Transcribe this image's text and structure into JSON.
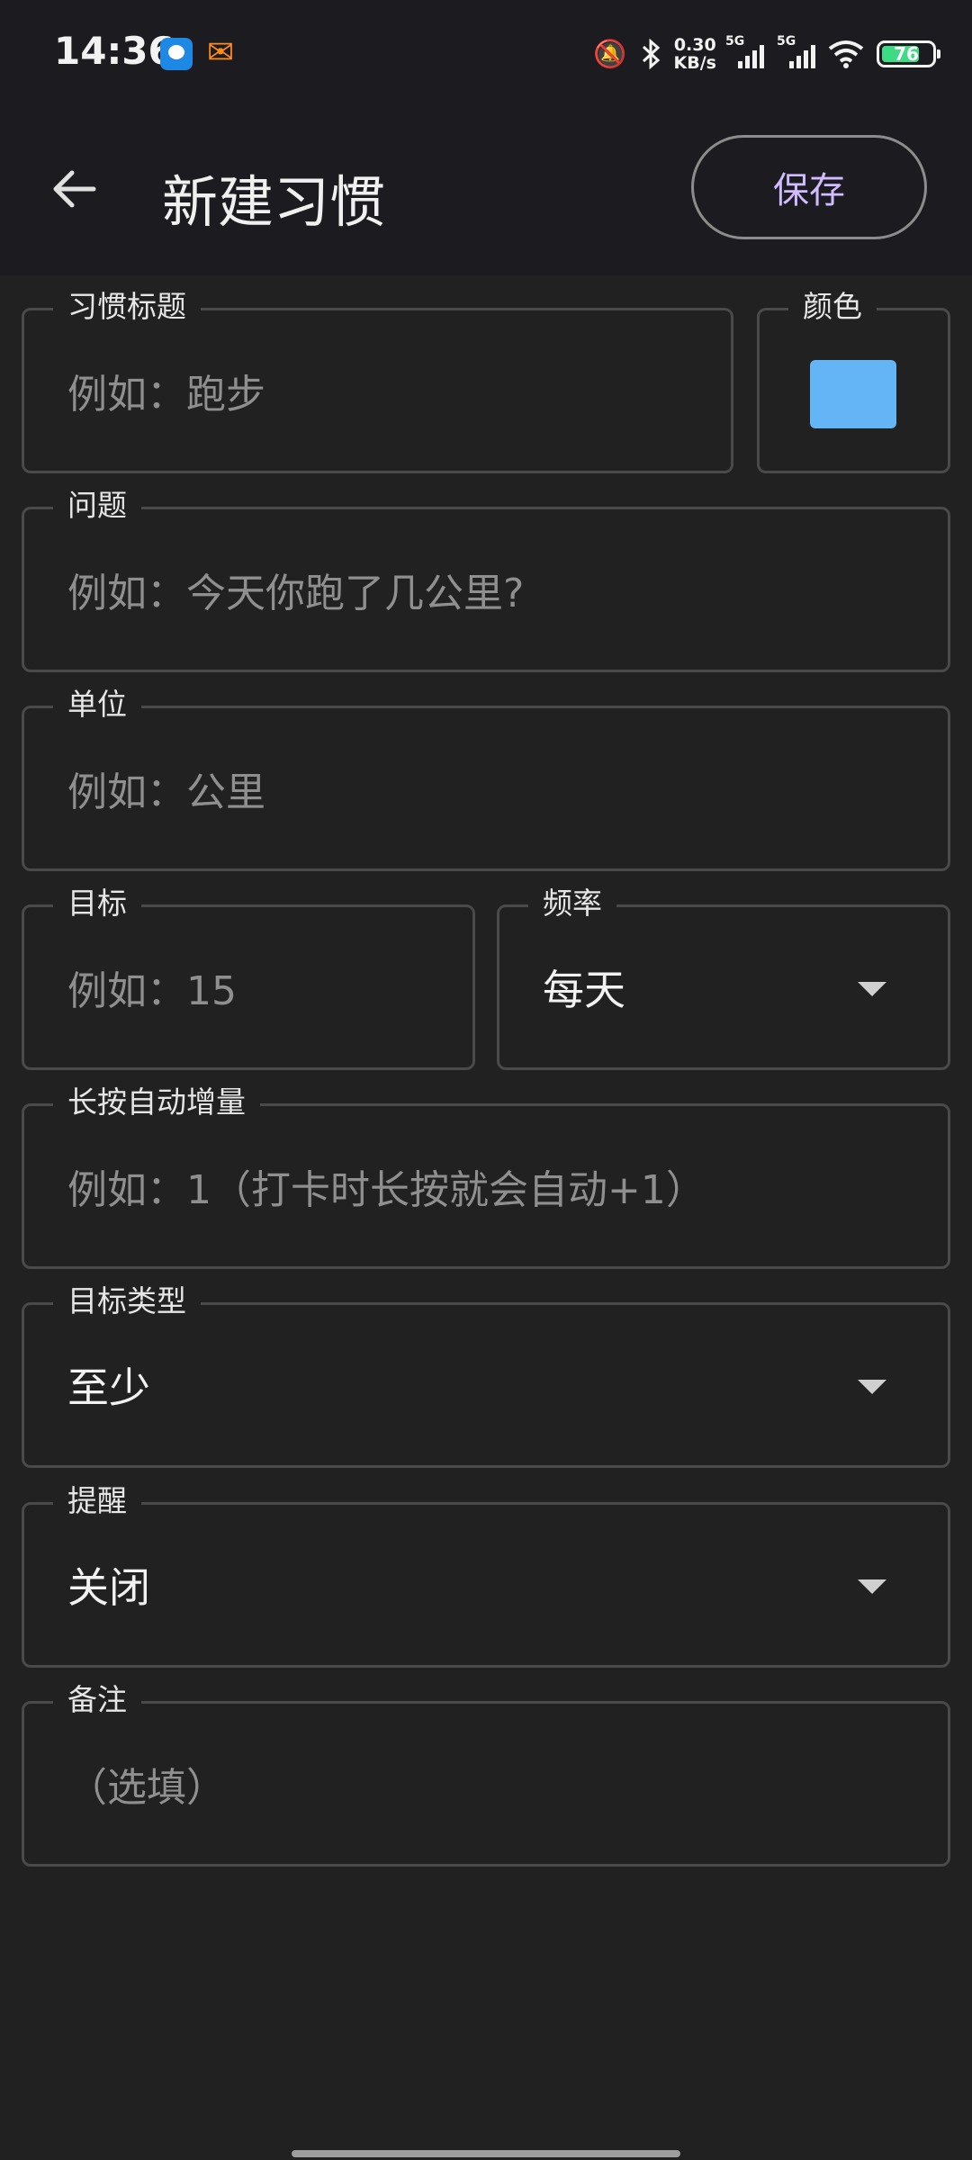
{
  "status_bar": {
    "time": "14:36",
    "net_speed_value": "0.30",
    "net_speed_unit": "KB/s",
    "sim1_tag": "5G",
    "sim2_tag": "5G",
    "battery_percent": "76",
    "battery_level": 0.76,
    "icons": [
      "bell-off-icon",
      "bluetooth-icon",
      "signal-icon",
      "signal-icon",
      "wifi-icon",
      "battery-icon"
    ]
  },
  "app_bar": {
    "back_icon": "arrow-left-icon",
    "title": "新建习惯",
    "save_label": "保存"
  },
  "form": {
    "habit_title": {
      "label": "习惯标题",
      "placeholder": "例如：跑步"
    },
    "color": {
      "label": "颜色",
      "value": "#64b5f6"
    },
    "question": {
      "label": "问题",
      "placeholder": "例如：今天你跑了几公里?"
    },
    "unit": {
      "label": "单位",
      "placeholder": "例如：公里"
    },
    "target": {
      "label": "目标",
      "placeholder": "例如：15"
    },
    "frequency": {
      "label": "频率",
      "value": "每天"
    },
    "long_press_increment": {
      "label": "长按自动增量",
      "placeholder": "例如：1（打卡时长按就会自动+1）"
    },
    "target_type": {
      "label": "目标类型",
      "value": "至少"
    },
    "reminder": {
      "label": "提醒",
      "value": "关闭"
    },
    "notes": {
      "label": "备注",
      "placeholder": "（选填）"
    }
  },
  "colors": {
    "background": "#212121",
    "bar_background": "#1c1c20",
    "accent": "#d0bcff",
    "outline": "#4a4a4a",
    "swatch": "#64b5f6"
  }
}
